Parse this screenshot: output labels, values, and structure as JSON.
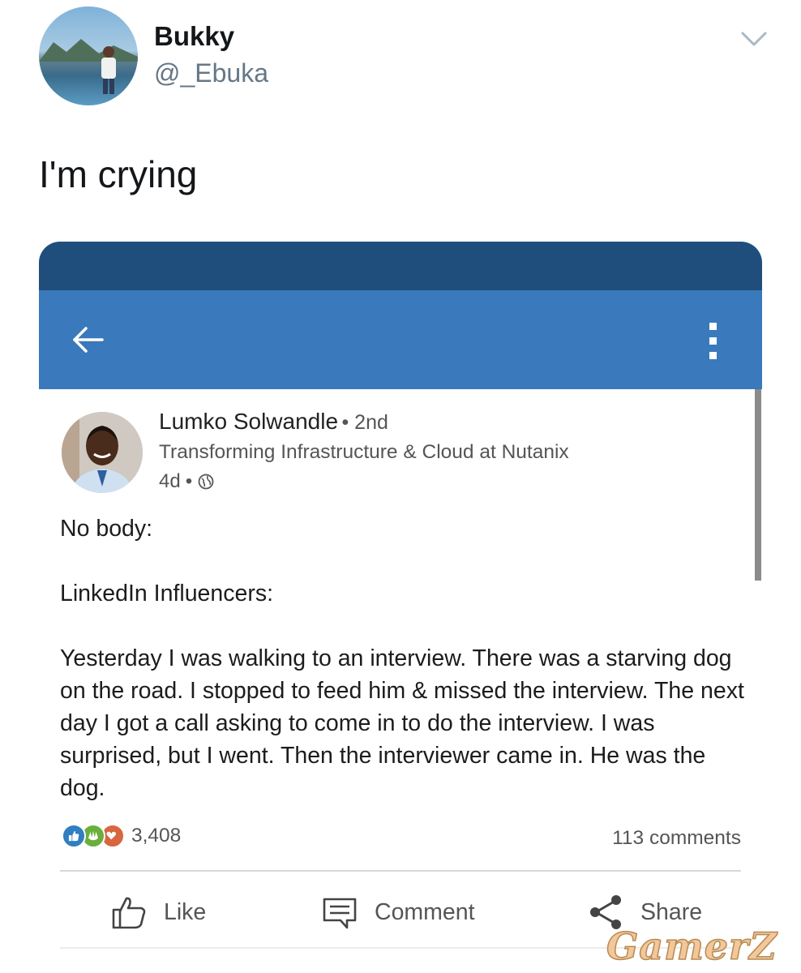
{
  "tweet": {
    "author_name": "Bukky",
    "handle": "@_Ebuka",
    "text": "I'm crying",
    "menu_icon": "chevron-down-icon"
  },
  "linkedin": {
    "colors": {
      "status_bar": "#1f4e7c",
      "app_bar": "#3a79bb",
      "like": "#2f7fc1",
      "celebrate": "#6cae3e",
      "love": "#d8663f"
    },
    "author": {
      "name": "Lumko Solwandle",
      "degree": "• 2nd",
      "headline": "Transforming Infrastructure & Cloud at Nutanix",
      "age": "4d",
      "separator": "•"
    },
    "body": {
      "p1": "No body:",
      "p2": "LinkedIn Influencers:",
      "p3": "Yesterday I was walking to an interview. There was a starving dog on the road. I stopped to feed him & missed the interview. The next day I got a call asking to come in to do the interview. I was surprised, but I went. Then the interviewer came in. He was the dog."
    },
    "reaction_count": "3,408",
    "comments_count": "113 comments",
    "actions": {
      "like": "Like",
      "comment": "Comment",
      "share": "Share"
    }
  },
  "watermark": "GamerZ"
}
